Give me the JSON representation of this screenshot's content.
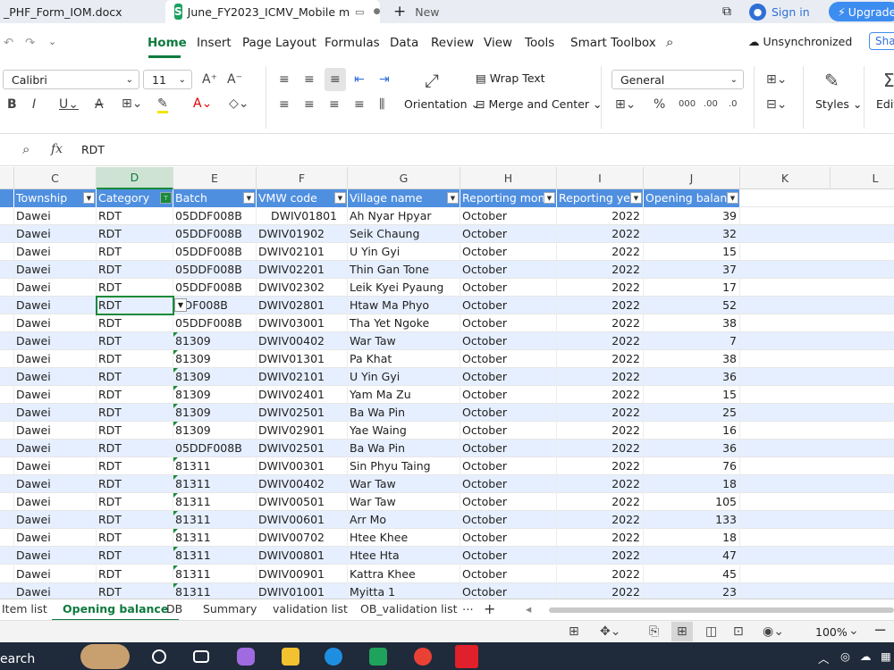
{
  "tabs": {
    "doc1": "_PHF_Form_IOM.docx",
    "doc2": "June_FY2023_ICMV_Mobile m",
    "new_label": "New",
    "signin": "Sign in",
    "upgrade": "Upgrade"
  },
  "menu": {
    "home": "Home",
    "insert": "Insert",
    "page_layout": "Page Layout",
    "formulas": "Formulas",
    "data": "Data",
    "review": "Review",
    "view": "View",
    "tools": "Tools",
    "smart_toolbox": "Smart Toolbox",
    "sync": "Unsynchronized",
    "share": "Share"
  },
  "ribbon": {
    "font_name": "Calibri",
    "font_size": "11",
    "wrap_text": "Wrap Text",
    "merge_center": "Merge and Center",
    "orientation": "Orientation",
    "number_format": "General",
    "styles": "Styles",
    "edit": "Edit"
  },
  "formula": {
    "content": "RDT",
    "fx": "fx"
  },
  "columns": [
    "C",
    "D",
    "E",
    "F",
    "G",
    "H",
    "I",
    "J",
    "K",
    "L"
  ],
  "headers": [
    "Township",
    "Category",
    "Batch",
    "VMW code",
    "Village name",
    "Reporting mon",
    "Reporting ye",
    "Opening balan"
  ],
  "rows": [
    [
      "Dawei",
      "RDT",
      "05DDF008B",
      "DWIV01801",
      "Ah Nyar Hpyar",
      "October",
      "2022",
      "39"
    ],
    [
      "Dawei",
      "RDT",
      "05DDF008B",
      "DWIV01902",
      "Seik Chaung",
      "October",
      "2022",
      "32"
    ],
    [
      "Dawei",
      "RDT",
      "05DDF008B",
      "DWIV02101",
      "U Yin Gyi",
      "October",
      "2022",
      "15"
    ],
    [
      "Dawei",
      "RDT",
      "05DDF008B",
      "DWIV02201",
      "Thin Gan Tone",
      "October",
      "2022",
      "37"
    ],
    [
      "Dawei",
      "RDT",
      "05DDF008B",
      "DWIV02302",
      "Leik Kyei Pyaung",
      "October",
      "2022",
      "17"
    ],
    [
      "Dawei",
      "RDT",
      "DDF008B",
      "DWIV02801",
      "Htaw Ma Phyo",
      "October",
      "2022",
      "52"
    ],
    [
      "Dawei",
      "RDT",
      "05DDF008B",
      "DWIV03001",
      "Tha Yet Ngoke",
      "October",
      "2022",
      "38"
    ],
    [
      "Dawei",
      "RDT",
      "81309",
      "DWIV00402",
      "War Taw",
      "October",
      "2022",
      "7"
    ],
    [
      "Dawei",
      "RDT",
      "81309",
      "DWIV01301",
      "Pa Khat",
      "October",
      "2022",
      "38"
    ],
    [
      "Dawei",
      "RDT",
      "81309",
      "DWIV02101",
      "U Yin Gyi",
      "October",
      "2022",
      "36"
    ],
    [
      "Dawei",
      "RDT",
      "81309",
      "DWIV02401",
      "Yam Ma Zu",
      "October",
      "2022",
      "15"
    ],
    [
      "Dawei",
      "RDT",
      "81309",
      "DWIV02501",
      "Ba Wa Pin",
      "October",
      "2022",
      "25"
    ],
    [
      "Dawei",
      "RDT",
      "81309",
      "DWIV02901",
      "Yae Waing",
      "October",
      "2022",
      "16"
    ],
    [
      "Dawei",
      "RDT",
      "05DDF008B",
      "DWIV02501",
      "Ba Wa Pin",
      "October",
      "2022",
      "36"
    ],
    [
      "Dawei",
      "RDT",
      "81311",
      "DWIV00301",
      "Sin Phyu Taing",
      "October",
      "2022",
      "76"
    ],
    [
      "Dawei",
      "RDT",
      "81311",
      "DWIV00402",
      "War Taw",
      "October",
      "2022",
      "18"
    ],
    [
      "Dawei",
      "RDT",
      "81311",
      "DWIV00501",
      "War Taw",
      "October",
      "2022",
      "105"
    ],
    [
      "Dawei",
      "RDT",
      "81311",
      "DWIV00601",
      "Arr Mo",
      "October",
      "2022",
      "133"
    ],
    [
      "Dawei",
      "RDT",
      "81311",
      "DWIV00702",
      "Htee Khee",
      "October",
      "2022",
      "18"
    ],
    [
      "Dawei",
      "RDT",
      "81311",
      "DWIV00801",
      "Htee Hta",
      "October",
      "2022",
      "47"
    ],
    [
      "Dawei",
      "RDT",
      "81311",
      "DWIV00901",
      "Kattra Khee",
      "October",
      "2022",
      "45"
    ],
    [
      "Dawei",
      "RDT",
      "81311",
      "DWIV01001",
      "Myitta 1",
      "October",
      "2022",
      "23"
    ]
  ],
  "sheets": [
    "Item list",
    "Opening balance",
    "DB",
    "Summary",
    "validation list",
    "OB_validation list"
  ],
  "status": {
    "zoom": "100%"
  },
  "taskbar": {
    "search": "earch"
  }
}
